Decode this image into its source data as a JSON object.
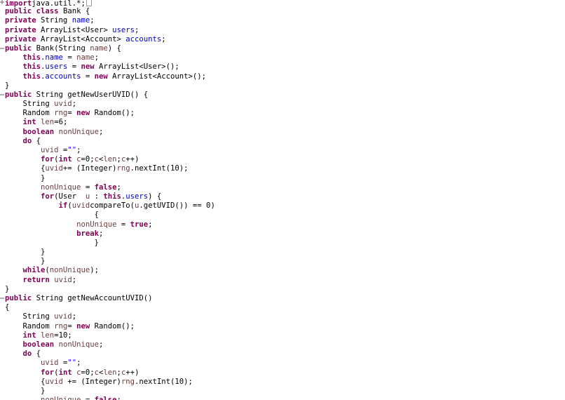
{
  "editor": {
    "lines": [
      {
        "fold": "plus",
        "segments": [
          [
            "kw",
            "import"
          ],
          [
            "",
            "java.util.*;"
          ],
          [
            "caret",
            ""
          ]
        ]
      },
      {
        "fold": "",
        "segments": [
          [
            "kw",
            "public"
          ],
          [
            "",
            " "
          ],
          [
            "kw",
            "class"
          ],
          [
            "",
            " Bank {"
          ]
        ]
      },
      {
        "fold": "",
        "segments": [
          [
            "kw",
            "private"
          ],
          [
            "",
            " String "
          ],
          [
            "fld",
            "name"
          ],
          [
            "",
            ";"
          ]
        ]
      },
      {
        "fold": "",
        "segments": [
          [
            "kw",
            "private"
          ],
          [
            "",
            " ArrayList<User> "
          ],
          [
            "fld",
            "users"
          ],
          [
            "",
            ";"
          ]
        ]
      },
      {
        "fold": "",
        "segments": [
          [
            "kw",
            "private"
          ],
          [
            "",
            " ArrayList<Account> "
          ],
          [
            "fld",
            "accounts"
          ],
          [
            "",
            ";"
          ]
        ]
      },
      {
        "fold": "minus",
        "segments": [
          [
            "kw",
            "public"
          ],
          [
            "",
            " Bank(String "
          ],
          [
            "loc",
            "name"
          ],
          [
            "",
            ") {"
          ]
        ]
      },
      {
        "fold": "",
        "segments": [
          [
            "",
            "    "
          ],
          [
            "kw",
            "this"
          ],
          [
            "",
            "."
          ],
          [
            "fld",
            "name"
          ],
          [
            "",
            " = "
          ],
          [
            "loc",
            "name"
          ],
          [
            "",
            ";"
          ]
        ]
      },
      {
        "fold": "",
        "segments": [
          [
            "",
            "    "
          ],
          [
            "kw",
            "this"
          ],
          [
            "",
            "."
          ],
          [
            "fld",
            "users"
          ],
          [
            "",
            " = "
          ],
          [
            "kw",
            "new"
          ],
          [
            "",
            " ArrayList<User>();"
          ]
        ]
      },
      {
        "fold": "",
        "segments": [
          [
            "",
            "    "
          ],
          [
            "kw",
            "this"
          ],
          [
            "",
            "."
          ],
          [
            "fld",
            "accounts"
          ],
          [
            "",
            " = "
          ],
          [
            "kw",
            "new"
          ],
          [
            "",
            " ArrayList<Account>();"
          ]
        ]
      },
      {
        "fold": "",
        "segments": [
          [
            "",
            "}"
          ]
        ]
      },
      {
        "fold": "minus",
        "segments": [
          [
            "kw",
            "public"
          ],
          [
            "",
            " String getNewUserUVID() {"
          ]
        ]
      },
      {
        "fold": "",
        "segments": [
          [
            "",
            "    String "
          ],
          [
            "loc",
            "uvid"
          ],
          [
            "",
            ";"
          ]
        ]
      },
      {
        "fold": "",
        "segments": [
          [
            "",
            "    Random "
          ],
          [
            "loc",
            "rng"
          ],
          [
            "",
            "= "
          ],
          [
            "kw",
            "new"
          ],
          [
            "",
            " Random();"
          ]
        ]
      },
      {
        "fold": "",
        "segments": [
          [
            "",
            "    "
          ],
          [
            "kw",
            "int"
          ],
          [
            "",
            " "
          ],
          [
            "loc",
            "len"
          ],
          [
            "",
            "=6;"
          ]
        ]
      },
      {
        "fold": "",
        "segments": [
          [
            "",
            "    "
          ],
          [
            "kw",
            "boolean"
          ],
          [
            "",
            " "
          ],
          [
            "loc",
            "nonUnique"
          ],
          [
            "",
            ";"
          ]
        ]
      },
      {
        "fold": "",
        "segments": [
          [
            "",
            "    "
          ],
          [
            "kw",
            "do"
          ],
          [
            "",
            " {"
          ]
        ]
      },
      {
        "fold": "",
        "segments": [
          [
            "",
            "        "
          ],
          [
            "loc",
            "uvid"
          ],
          [
            "",
            " ="
          ],
          [
            "str",
            "\"\""
          ],
          [
            "",
            ";"
          ]
        ]
      },
      {
        "fold": "",
        "segments": [
          [
            "",
            "        "
          ],
          [
            "kw",
            "for"
          ],
          [
            "",
            "("
          ],
          [
            "kw",
            "int"
          ],
          [
            "",
            " "
          ],
          [
            "loc",
            "c"
          ],
          [
            "",
            "=0;"
          ],
          [
            "loc",
            "c"
          ],
          [
            "",
            "<"
          ],
          [
            "loc",
            "len"
          ],
          [
            "",
            ";"
          ],
          [
            "loc",
            "c"
          ],
          [
            "",
            "++)"
          ]
        ]
      },
      {
        "fold": "",
        "segments": [
          [
            "",
            "        {"
          ],
          [
            "loc",
            "uvid"
          ],
          [
            "",
            "+= (Integer)"
          ],
          [
            "loc",
            "rng"
          ],
          [
            "",
            ".nextInt(10);"
          ]
        ]
      },
      {
        "fold": "",
        "segments": [
          [
            "",
            "        }"
          ]
        ]
      },
      {
        "fold": "",
        "segments": [
          [
            "",
            "        "
          ],
          [
            "loc",
            "nonUnique"
          ],
          [
            "",
            " = "
          ],
          [
            "kw",
            "false"
          ],
          [
            "",
            ";"
          ]
        ]
      },
      {
        "fold": "",
        "segments": [
          [
            "",
            "        "
          ],
          [
            "kw",
            "for"
          ],
          [
            "",
            "(User  "
          ],
          [
            "loc",
            "u"
          ],
          [
            "",
            " : "
          ],
          [
            "kw",
            "this"
          ],
          [
            "",
            "."
          ],
          [
            "fld",
            "users"
          ],
          [
            "",
            ") {"
          ]
        ]
      },
      {
        "fold": "",
        "segments": [
          [
            "",
            "            "
          ],
          [
            "kw",
            "if"
          ],
          [
            "",
            "("
          ],
          [
            "loc",
            "uvid"
          ],
          [
            "",
            "compareTo("
          ],
          [
            "loc",
            "u"
          ],
          [
            "",
            ".getUVID()) == 0)"
          ]
        ]
      },
      {
        "fold": "",
        "segments": [
          [
            "",
            "                    {"
          ]
        ]
      },
      {
        "fold": "",
        "segments": [
          [
            "",
            "                "
          ],
          [
            "loc",
            "nonUnique"
          ],
          [
            "",
            " = "
          ],
          [
            "kw",
            "true"
          ],
          [
            "",
            ";"
          ]
        ]
      },
      {
        "fold": "",
        "segments": [
          [
            "",
            "                "
          ],
          [
            "kw",
            "break"
          ],
          [
            "",
            ";"
          ]
        ]
      },
      {
        "fold": "",
        "segments": [
          [
            "",
            "                    }"
          ]
        ]
      },
      {
        "fold": "",
        "segments": [
          [
            "",
            "        }"
          ]
        ]
      },
      {
        "fold": "",
        "segments": [
          [
            "",
            "        }"
          ]
        ]
      },
      {
        "fold": "",
        "segments": [
          [
            "",
            "    "
          ],
          [
            "kw",
            "while"
          ],
          [
            "",
            "("
          ],
          [
            "loc",
            "nonUnique"
          ],
          [
            "",
            ");"
          ]
        ]
      },
      {
        "fold": "",
        "segments": [
          [
            "",
            "    "
          ],
          [
            "kw",
            "return"
          ],
          [
            "",
            " "
          ],
          [
            "loc",
            "uvid"
          ],
          [
            "",
            ";"
          ]
        ]
      },
      {
        "fold": "",
        "segments": [
          [
            "",
            "}"
          ]
        ]
      },
      {
        "fold": "minus",
        "segments": [
          [
            "kw",
            "public"
          ],
          [
            "",
            " String getNewAccountUVID()"
          ]
        ]
      },
      {
        "fold": "",
        "segments": [
          [
            "",
            "{"
          ]
        ]
      },
      {
        "fold": "",
        "segments": [
          [
            "",
            "    String "
          ],
          [
            "loc",
            "uvid"
          ],
          [
            "",
            ";"
          ]
        ]
      },
      {
        "fold": "",
        "segments": [
          [
            "",
            "    Random "
          ],
          [
            "loc",
            "rng"
          ],
          [
            "",
            "= "
          ],
          [
            "kw",
            "new"
          ],
          [
            "",
            " Random();"
          ]
        ]
      },
      {
        "fold": "",
        "segments": [
          [
            "",
            "    "
          ],
          [
            "kw",
            "int"
          ],
          [
            "",
            " "
          ],
          [
            "loc",
            "len"
          ],
          [
            "",
            "=10;"
          ]
        ]
      },
      {
        "fold": "",
        "segments": [
          [
            "",
            "    "
          ],
          [
            "kw",
            "boolean"
          ],
          [
            "",
            " "
          ],
          [
            "loc",
            "nonUnique"
          ],
          [
            "",
            ";"
          ]
        ]
      },
      {
        "fold": "",
        "segments": [
          [
            "",
            "    "
          ],
          [
            "kw",
            "do"
          ],
          [
            "",
            " {"
          ]
        ]
      },
      {
        "fold": "",
        "segments": [
          [
            "",
            "        "
          ],
          [
            "loc",
            "uvid"
          ],
          [
            "",
            " ="
          ],
          [
            "str",
            "\"\""
          ],
          [
            "",
            ";"
          ]
        ]
      },
      {
        "fold": "",
        "segments": [
          [
            "",
            "        "
          ],
          [
            "kw",
            "for"
          ],
          [
            "",
            "("
          ],
          [
            "kw",
            "int"
          ],
          [
            "",
            " "
          ],
          [
            "loc",
            "c"
          ],
          [
            "",
            "=0;"
          ],
          [
            "loc",
            "c"
          ],
          [
            "",
            "<"
          ],
          [
            "loc",
            "len"
          ],
          [
            "",
            ";"
          ],
          [
            "loc",
            "c"
          ],
          [
            "",
            "++)"
          ]
        ]
      },
      {
        "fold": "",
        "segments": [
          [
            "",
            "        {"
          ],
          [
            "loc",
            "uvid"
          ],
          [
            "",
            " += (Integer)"
          ],
          [
            "loc",
            "rng"
          ],
          [
            "",
            ".nextInt(10);"
          ]
        ]
      },
      {
        "fold": "",
        "segments": [
          [
            "",
            "        }"
          ]
        ]
      },
      {
        "fold": "",
        "segments": [
          [
            "",
            "        "
          ],
          [
            "loc",
            "nonUnique"
          ],
          [
            "",
            " = "
          ],
          [
            "kw",
            "false"
          ],
          [
            "",
            ";"
          ]
        ]
      }
    ]
  }
}
